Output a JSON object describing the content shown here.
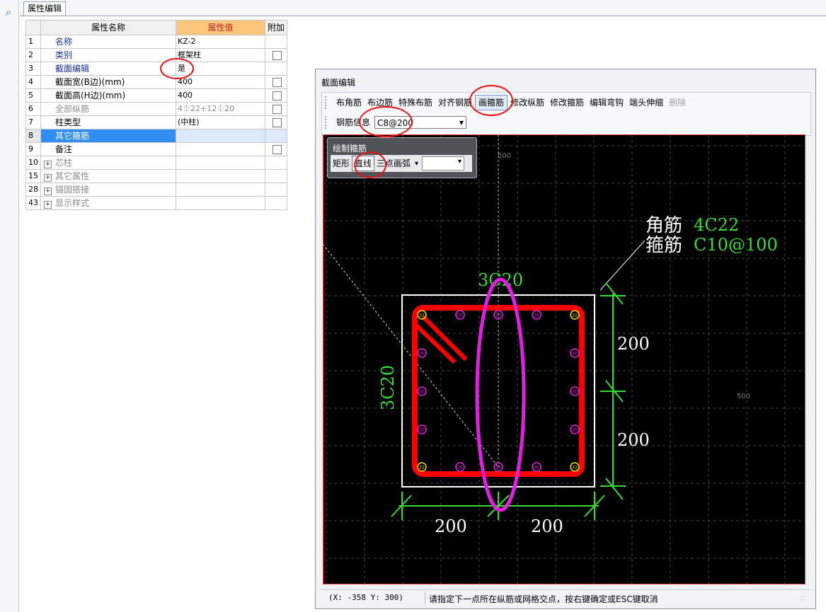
{
  "tab": {
    "label": "属性编辑"
  },
  "table": {
    "headers": {
      "name": "属性名称",
      "value": "属性值",
      "extra": "附加"
    },
    "rows": [
      {
        "num": "1",
        "name": "名称",
        "value": "KZ-2",
        "checkbox": false,
        "color": "blue"
      },
      {
        "num": "2",
        "name": "类别",
        "value": "框架柱",
        "checkbox": true,
        "color": "blue"
      },
      {
        "num": "3",
        "name": "截面编辑",
        "value": "是",
        "checkbox": false,
        "color": "blue"
      },
      {
        "num": "4",
        "name": "截面宽(B边)(mm)",
        "value": "400",
        "checkbox": true,
        "color": "black"
      },
      {
        "num": "5",
        "name": "截面高(H边)(mm)",
        "value": "400",
        "checkbox": true,
        "color": "black"
      },
      {
        "num": "6",
        "name": "全部纵筋",
        "value": "4⏀22+12⏀20",
        "checkbox": true,
        "color": "gray"
      },
      {
        "num": "7",
        "name": "柱类型",
        "value": "(中柱)",
        "checkbox": true,
        "color": "black"
      },
      {
        "num": "8",
        "name": "其它箍筋",
        "value": "",
        "checkbox": false,
        "color": "black",
        "selected": true
      },
      {
        "num": "9",
        "name": "备注",
        "value": "",
        "checkbox": true,
        "color": "black"
      },
      {
        "num": "10",
        "name": "芯柱",
        "value": "",
        "checkbox": false,
        "color": "gray",
        "expand": true
      },
      {
        "num": "15",
        "name": "其它属性",
        "value": "",
        "checkbox": false,
        "color": "gray",
        "expand": true
      },
      {
        "num": "28",
        "name": "锚固搭接",
        "value": "",
        "checkbox": false,
        "color": "gray",
        "expand": true
      },
      {
        "num": "43",
        "name": "显示样式",
        "value": "",
        "checkbox": false,
        "color": "gray",
        "expand": true
      }
    ]
  },
  "dialog": {
    "title": "截面编辑",
    "toolbar": [
      "布角筋",
      "布边筋",
      "特殊布筋",
      "对齐钢筋",
      "画箍筋",
      "修改纵筋",
      "修改箍筋",
      "编辑弯钩",
      "端头伸缩",
      "删除"
    ],
    "toolbar_active": "画箍筋",
    "toolbar_disabled": "删除",
    "rebar_info_label": "钢筋信息",
    "rebar_info_value": "C8@200",
    "subpanel": {
      "title": "绘制箍筋",
      "buttons": [
        "矩形",
        "直线",
        "三点画弧"
      ],
      "active": "直线"
    },
    "status": {
      "coords": "(X: -358 Y: 300)",
      "message": "请指定下一点所在纵筋或网格交点，按右键确定或ESC键取消"
    }
  },
  "drawing": {
    "top_grid_label": "500",
    "right_grid_label": "500",
    "corner_bar_label": "角筋",
    "corner_bar_value": "4C22",
    "stirrup_label": "箍筋",
    "stirrup_value": "C10@100",
    "top_rebar": "3C20",
    "left_rebar": "3C20",
    "dims": {
      "right_upper": "200",
      "right_lower": "200",
      "bottom_left": "200",
      "bottom_right": "200"
    },
    "corner_bar_text": "22",
    "side_bar_text": "20",
    "colors": {
      "bg": "#000000",
      "stirrup": "#ff0000",
      "dim": "#33dd33",
      "side_bar": "#e21ee2",
      "corner_bar": "#f0e000",
      "outline": "#ffffff",
      "highlight": "#e21ee2"
    }
  }
}
